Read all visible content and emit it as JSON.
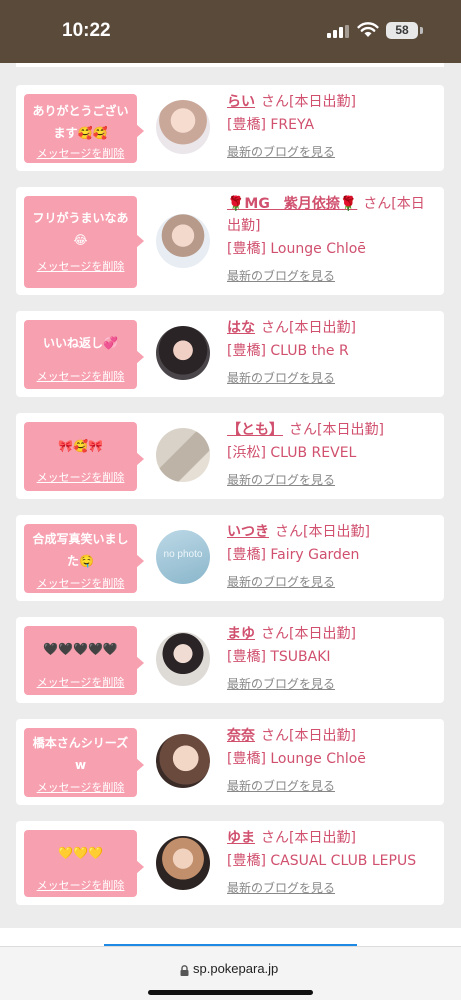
{
  "status_bar": {
    "time": "10:22",
    "battery": "58"
  },
  "browser": {
    "url": "sp.pokepara.jp"
  },
  "colors": {
    "status_bar_bg": "#5a4a3a",
    "bubble": "#f7a0b0",
    "accent_text": "#d0506e",
    "link_gray": "#888888"
  },
  "messages": [
    {
      "text": "ありがとうございます🥰🥰",
      "delete_label": "メッセージを削除",
      "avatar_icon": "cast-photo",
      "name": "らい",
      "suffix": "さん[本日出勤]",
      "shop": "[豊橋] FREYA",
      "blog_link": "最新のブログを見る"
    },
    {
      "text": "フリがうまいなあ😂",
      "delete_label": "メッセージを削除",
      "avatar_icon": "cast-photo",
      "name": "🌹MG　紫月依捺🌹",
      "suffix": "さん[本日出勤]",
      "shop": "[豊橋] Lounge Chloē",
      "blog_link": "最新のブログを見る"
    },
    {
      "text": "いいね返し💞",
      "delete_label": "メッセージを削除",
      "avatar_icon": "cast-photo",
      "name": "はな",
      "suffix": "さん[本日出勤]",
      "shop": "[豊橋] CLUB the R",
      "blog_link": "最新のブログを見る"
    },
    {
      "text": "🎀🥰🎀",
      "delete_label": "メッセージを削除",
      "avatar_icon": "cast-photo",
      "name": "【とも】",
      "suffix": "さん[本日出勤]",
      "shop": "[浜松] CLUB REVEL",
      "blog_link": "最新のブログを見る"
    },
    {
      "text": "合成写真笑いました🤤",
      "delete_label": "メッセージを削除",
      "avatar_icon": "no-photo-placeholder",
      "avatar_text": "no photo",
      "name": "いつき",
      "suffix": "さん[本日出勤]",
      "shop": "[豊橋] Fairy Garden",
      "blog_link": "最新のブログを見る"
    },
    {
      "text": "🖤🖤🖤🖤🖤",
      "delete_label": "メッセージを削除",
      "avatar_icon": "cast-photo",
      "name": "まゆ",
      "suffix": "さん[本日出勤]",
      "shop": "[豊橋] TSUBAKI",
      "blog_link": "最新のブログを見る"
    },
    {
      "text": "橋本さんシリーズw",
      "delete_label": "メッセージを削除",
      "avatar_icon": "cast-photo",
      "name": "奈奈",
      "suffix": "さん[本日出勤]",
      "shop": "[豊橋] Lounge Chloē",
      "blog_link": "最新のブログを見る"
    },
    {
      "text": "💛💛💛",
      "delete_label": "メッセージを削除",
      "avatar_icon": "cast-photo",
      "name": "ゆま",
      "suffix": "さん[本日出勤]",
      "shop": "[豊橋] CASUAL CLUB LEPUS",
      "blog_link": "最新のブログを見る"
    }
  ]
}
